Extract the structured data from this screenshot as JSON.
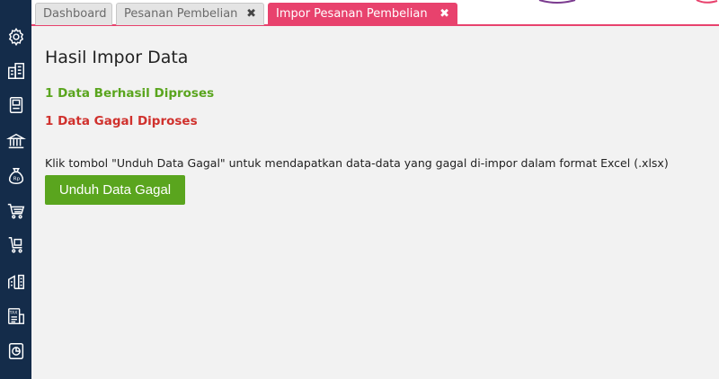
{
  "sidebar": {
    "icons": [
      "gear-icon",
      "building-icon",
      "book-icon",
      "bank-icon",
      "money-bag-icon",
      "cart-icon",
      "cart-box-icon",
      "warehouse-icon",
      "tax-icon",
      "report-icon"
    ]
  },
  "tabs": [
    {
      "label": "Dashboard",
      "active": false,
      "closable": false
    },
    {
      "label": "Pesanan Pembelian",
      "active": false,
      "closable": true
    },
    {
      "label": "Impor Pesanan Pembelian",
      "active": true,
      "closable": true
    }
  ],
  "close_glyph": "✖",
  "main": {
    "title": "Hasil Impor Data",
    "success_text": "1 Data Berhasil Diproses",
    "failed_text": "1 Data Gagal Diproses",
    "instruction": "Klik tombol \"Unduh Data Gagal\" untuk mendapatkan data-data yang gagal di-impor dalam format Excel (.xlsx)",
    "download_button": "Unduh Data Gagal"
  },
  "colors": {
    "sidebar": "#142c4a",
    "accent": "#e8426d",
    "success": "#5aa51e",
    "error": "#d0312d"
  }
}
